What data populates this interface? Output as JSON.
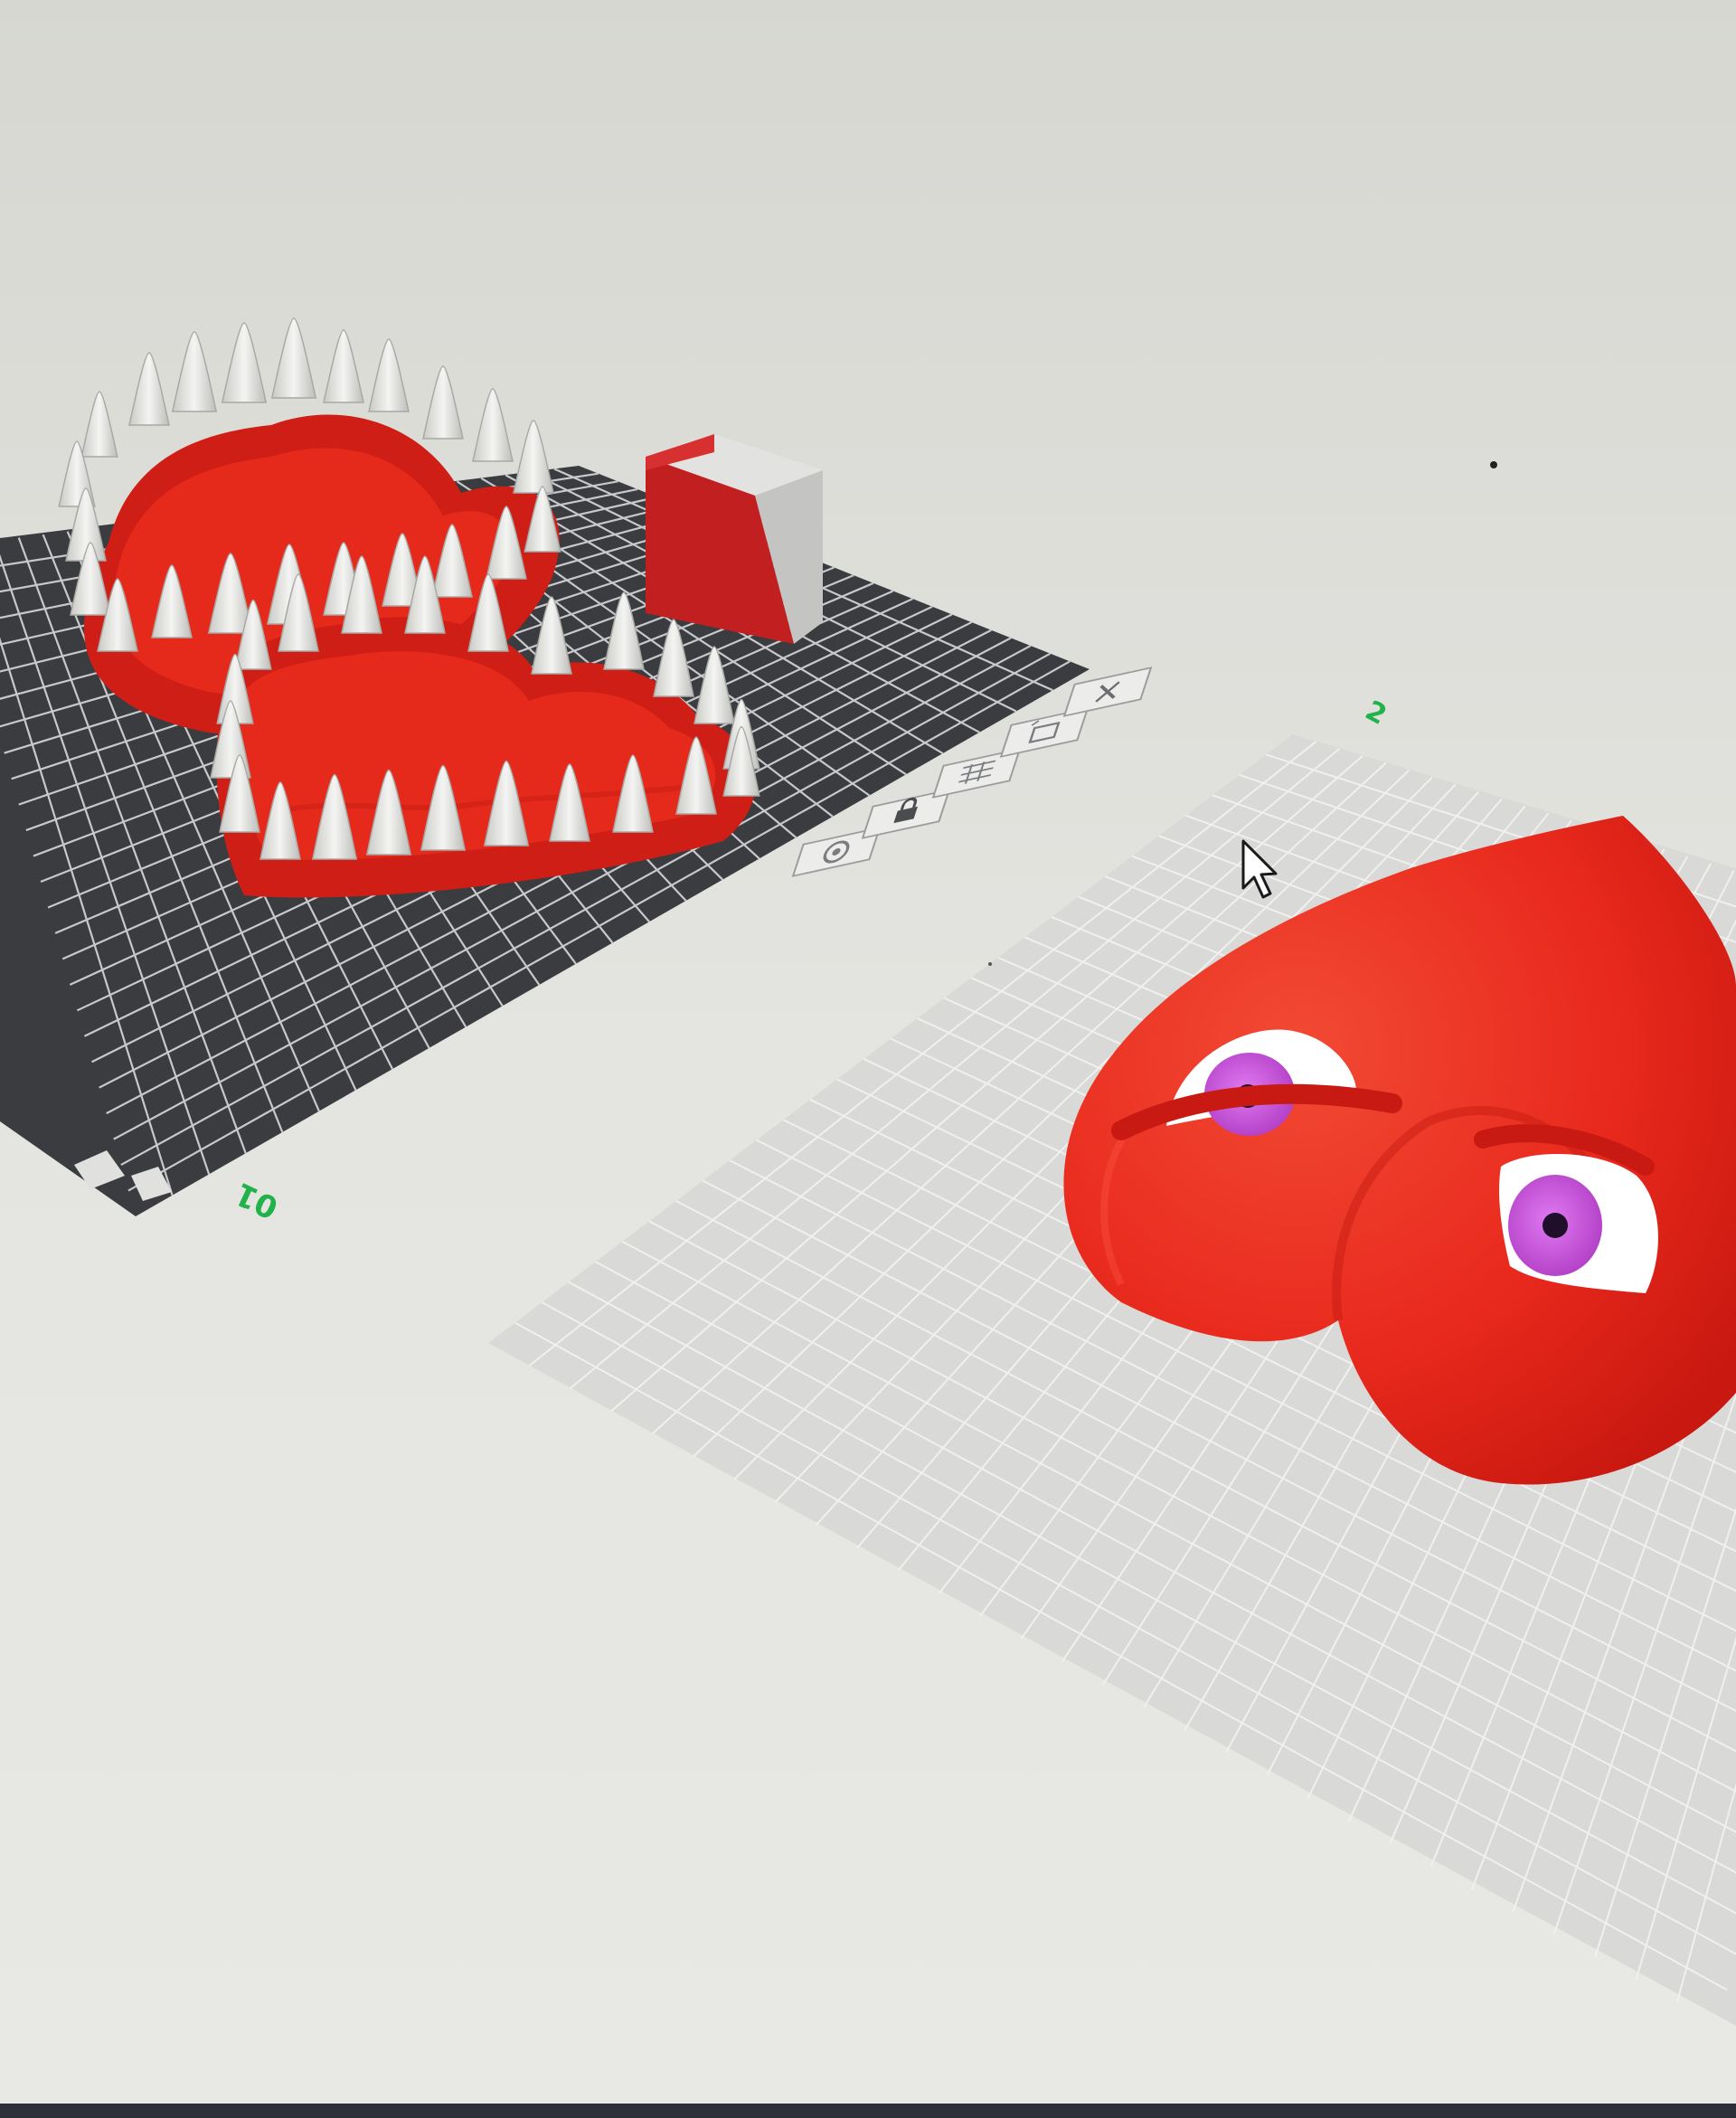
{
  "viewport": {
    "background_top": "#d8d9d3",
    "background_bottom": "#e6e6e2",
    "status_bar_color": "#2c3038"
  },
  "plates": [
    {
      "name": "plate-1",
      "number_label": "01",
      "label_color": "#22b24c",
      "surface": "dark",
      "surface_color": "#3a3c40",
      "grid_line_color": "#c7c9cc",
      "selected": true,
      "toolbar_icons": [
        "settings-gear-icon",
        "lock-icon",
        "arrange-grid-icon",
        "auto-orient-icon",
        "close-icon"
      ]
    },
    {
      "name": "plate-2",
      "number_label": "2",
      "label_color": "#22b24c",
      "surface": "light",
      "surface_color": "#d9dad7",
      "grid_line_color": "#f0f0ee",
      "selected": false
    }
  ],
  "models": [
    {
      "name": "heart-jaw-upper",
      "plate": 1,
      "colors": [
        "#e3231c",
        "#e8e8e6"
      ]
    },
    {
      "name": "heart-jaw-lower",
      "plate": 1,
      "colors": [
        "#e3231c",
        "#e8e8e6"
      ]
    },
    {
      "name": "prime-tower",
      "plate": 1,
      "colors": [
        "#c82222",
        "#dcdcda"
      ]
    },
    {
      "name": "heart-with-eyes",
      "plate": 2,
      "colors": [
        "#ec2a1c",
        "#ffffff",
        "#c84fd8",
        "#1f0f2a"
      ]
    }
  ],
  "cursor": {
    "icon": "arrow-cursor-icon"
  }
}
